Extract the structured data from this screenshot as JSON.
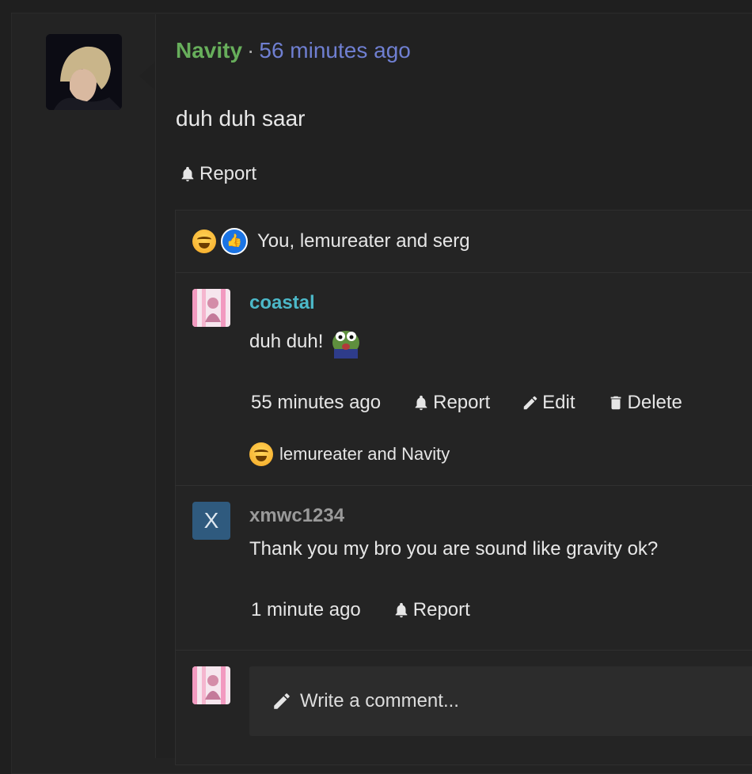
{
  "post": {
    "author": "Navity",
    "separator": "·",
    "time": "56 minutes ago",
    "body": "duh duh saar",
    "report_label": "Report"
  },
  "reactions": {
    "summary": "You, lemureater and serg",
    "icons": [
      "laughing-crying-emoji",
      "thumbs-up-emoji"
    ]
  },
  "comments": [
    {
      "author": "coastal",
      "body": "duh duh!",
      "time": "55 minutes ago",
      "report_label": "Report",
      "edit_label": "Edit",
      "delete_label": "Delete",
      "reaction_summary": "lemureater and Navity"
    },
    {
      "avatar_letter": "X",
      "author": "xmwc1234",
      "body": "Thank you my bro you are sound like gravity ok?",
      "time": "1 minute ago",
      "report_label": "Report"
    }
  ],
  "composer": {
    "placeholder": "Write a comment..."
  },
  "colors": {
    "author_navity": "#67ae5b",
    "time_link": "#6f7fd1",
    "author_coastal": "#4cb8c8",
    "author_xmwc": "#9a9a9a"
  }
}
